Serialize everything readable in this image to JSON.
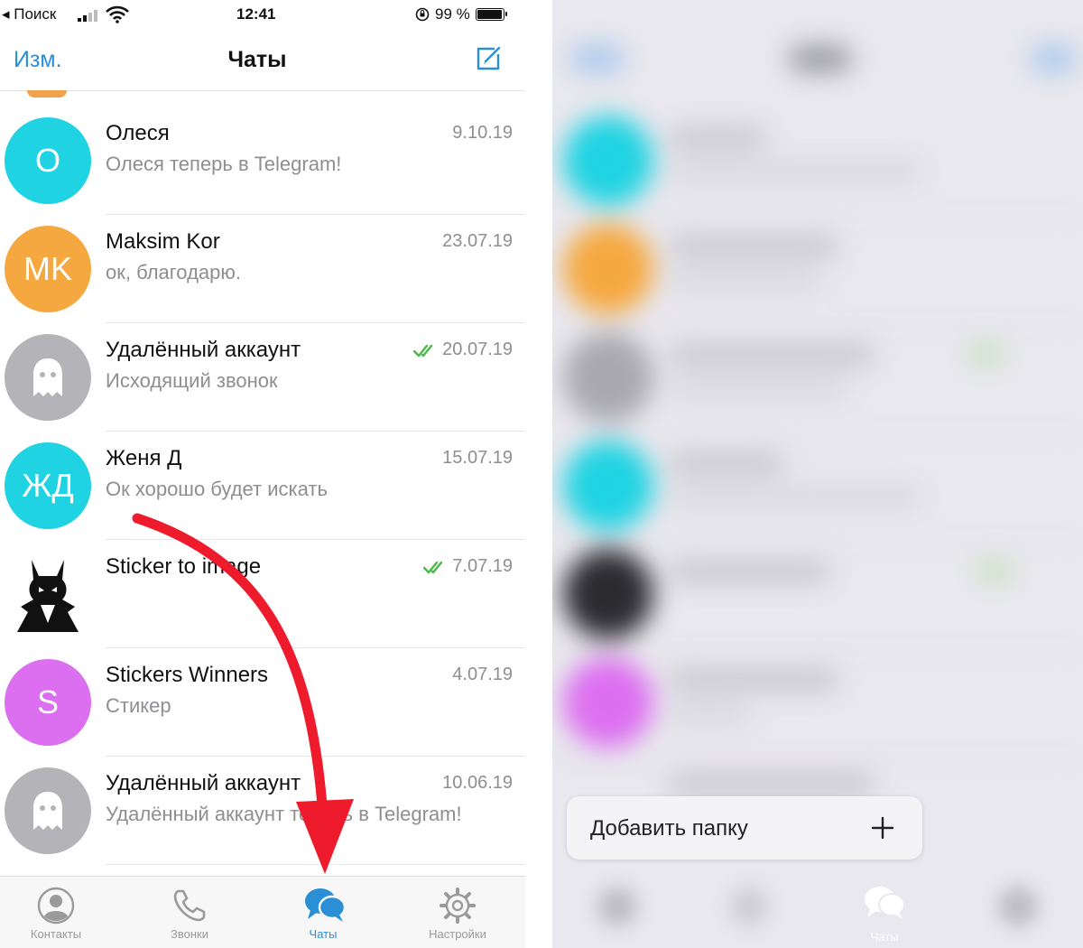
{
  "status_bar": {
    "back_label": "◂ Поиск",
    "time": "12:41",
    "battery": "99 %",
    "battery_level": 0.99
  },
  "nav": {
    "edit_label": "Изм.",
    "title": "Чаты",
    "compose_icon": "compose-icon"
  },
  "chats": [
    {
      "name": "Олеся",
      "preview": "Олеся теперь в Telegram!",
      "date": "9.10.19",
      "initials": "О",
      "color": "#1fd3e2",
      "read": false
    },
    {
      "name": "Maksim Kor",
      "preview": "ок, благодарю.",
      "date": "23.07.19",
      "initials": "MK",
      "color": "#f5a83f",
      "read": false
    },
    {
      "name": "Удалённый аккаунт",
      "preview": "Исходящий звонок",
      "date": "20.07.19",
      "initials": "",
      "color": "#b4b4b8",
      "read": true,
      "icon": "ghost-icon"
    },
    {
      "name": "Женя Д",
      "preview": "Ок хорошо будет искать",
      "date": "15.07.19",
      "initials": "ЖД",
      "color": "#1fd3e2",
      "read": false
    },
    {
      "name": "Sticker to image",
      "preview": "",
      "date": "7.07.19",
      "initials": "",
      "color": "#ffffff",
      "read": true,
      "icon": "devil-icon"
    },
    {
      "name": "Stickers Winners",
      "preview": "Стикер",
      "date": "4.07.19",
      "initials": "S",
      "color": "#dc6ff0",
      "read": false
    },
    {
      "name": "Удалённый аккаунт",
      "preview": "Удалённый аккаунт теперь в Telegram!",
      "date": "10.06.19",
      "initials": "",
      "color": "#b4b4b8",
      "read": false,
      "icon": "ghost-icon"
    }
  ],
  "tabs": [
    {
      "label": "Контакты",
      "icon": "person-icon",
      "active": false
    },
    {
      "label": "Звонки",
      "icon": "phone-icon",
      "active": false
    },
    {
      "label": "Чаты",
      "icon": "chat-bubbles-icon",
      "active": true
    },
    {
      "label": "Настройки",
      "icon": "gear-icon",
      "active": false
    }
  ],
  "context_menu": {
    "add_folder_label": "Добавить папку",
    "add_icon": "plus-icon"
  },
  "right_tab": {
    "label": "Чаты"
  },
  "colors": {
    "accent": "#2b8fd6",
    "arrow": "#ee1b2c",
    "check": "#4cb84a",
    "muted": "#8e8e93"
  }
}
